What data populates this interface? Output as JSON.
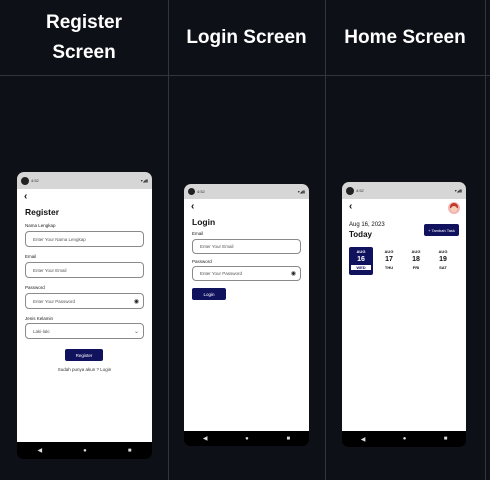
{
  "headers": {
    "register": "Register Screen",
    "login": "Login Screen",
    "home": "Home Screen"
  },
  "status_bar": {
    "time_register": "4:52",
    "time_login": "4:52",
    "time_home": "4:52",
    "right_icons": "▾◢▮"
  },
  "nav_bar": {
    "back": "◀",
    "home": "●",
    "recents": "■"
  },
  "register": {
    "back_icon": "‹",
    "title": "Register",
    "name_label": "Nama Lengkap",
    "name_placeholder": "Enter Your Nama Lengkap",
    "email_label": "Email",
    "email_placeholder": "Enter Your Email",
    "password_label": "Password",
    "password_placeholder": "Enter Your Password",
    "gender_label": "Jenis Kelamin",
    "gender_value": "Laki-laki",
    "register_button": "Register",
    "login_link": "Sudah punya akun ? Login"
  },
  "login": {
    "back_icon": "‹",
    "title": "Login",
    "email_label": "Email",
    "email_placeholder": "Enter Your Email",
    "password_label": "Password",
    "password_placeholder": "Enter Your Password",
    "login_button": "Login"
  },
  "home": {
    "back_icon": "‹",
    "date": "Aug 16, 2023",
    "today": "Today",
    "add_task_button": "+ Tambah Task",
    "days": [
      {
        "month": "AUG",
        "day": "16",
        "weekday": "WED",
        "selected": true
      },
      {
        "month": "AUG",
        "day": "17",
        "weekday": "THU",
        "selected": false
      },
      {
        "month": "AUG",
        "day": "18",
        "weekday": "FRI",
        "selected": false
      },
      {
        "month": "AUG",
        "day": "19",
        "weekday": "SAT",
        "selected": false
      }
    ]
  },
  "colors": {
    "background": "#0d1117",
    "accent": "#10125e",
    "grid_line": "#30363d"
  }
}
